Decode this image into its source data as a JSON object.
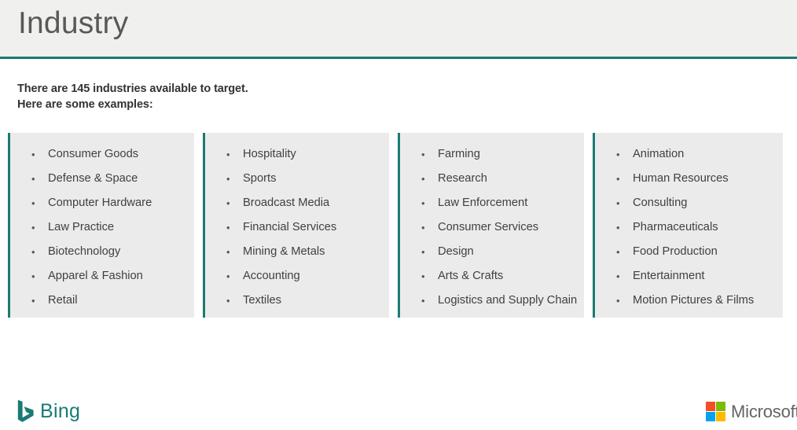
{
  "header": {
    "title": "Industry",
    "accent_color": "#1a7b74",
    "background_color": "#f0f0ef"
  },
  "intro": {
    "line1": "There are 145 industries available to target.",
    "line2": "Here are some examples:",
    "industry_count": 145
  },
  "columns": [
    {
      "id": "column-1",
      "items": [
        "Consumer Goods",
        "Defense & Space",
        "Computer Hardware",
        "Law Practice",
        "Biotechnology",
        "Apparel & Fashion",
        "Retail"
      ]
    },
    {
      "id": "column-2",
      "items": [
        "Hospitality",
        "Sports",
        "Broadcast Media",
        "Financial Services",
        "Mining & Metals",
        "Accounting",
        "Textiles"
      ]
    },
    {
      "id": "column-3",
      "items": [
        "Farming",
        "Research",
        "Law Enforcement",
        "Consumer Services",
        "Design",
        "Arts & Crafts",
        "Logistics and Supply Chain"
      ]
    },
    {
      "id": "column-4",
      "items": [
        "Animation",
        "Human Resources",
        "Consulting",
        "Pharmaceuticals",
        "Food Production",
        "Entertainment",
        "Motion Pictures & Films"
      ]
    }
  ],
  "bullet_glyph": "•",
  "footer": {
    "bing": {
      "wordmark": "Bing",
      "icon": "bing-b-logo-icon",
      "color": "#1a7b74"
    },
    "microsoft": {
      "wordmark": "Microsoft",
      "icon": "microsoft-four-squares-icon",
      "square_colors": [
        "#f25022",
        "#7fba00",
        "#00a4ef",
        "#ffb900"
      ],
      "text_color": "#636363"
    }
  },
  "card_style": {
    "background_color": "#ebebeb",
    "left_border_color": "#1a7b74",
    "text_color": "#404040"
  }
}
